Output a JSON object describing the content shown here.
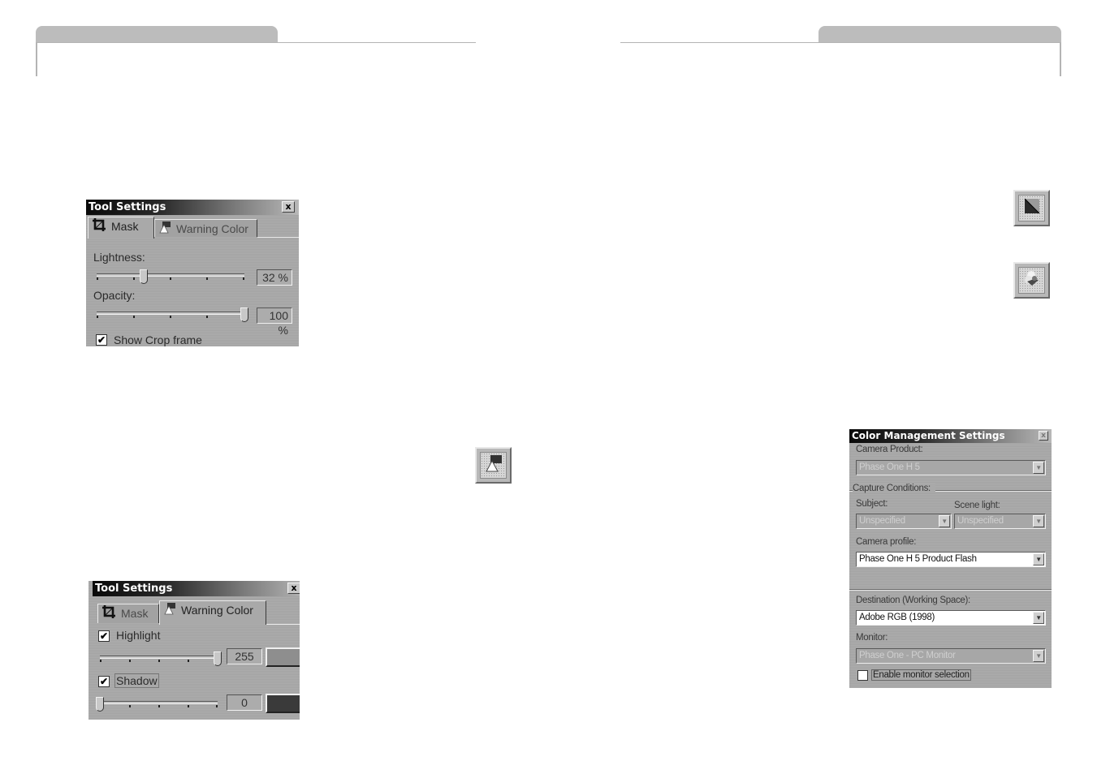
{
  "page": {
    "background": "#ffffff",
    "header_tab_color": "#bcbcbc"
  },
  "tool_settings_mask": {
    "title": "Tool Settings",
    "close_label": "x",
    "tabs": [
      {
        "label": "Mask",
        "icon": "crop-icon",
        "active": true
      },
      {
        "label": "Warning Color",
        "icon": "warning-color-icon",
        "active": false
      }
    ],
    "lightness": {
      "label": "Lightness:",
      "value": 32,
      "display": "32 %"
    },
    "opacity": {
      "label": "Opacity:",
      "value": 100,
      "display": "100 %"
    },
    "show_crop_frame": {
      "label": "Show Crop frame",
      "checked": true,
      "check_glyph": "✔"
    }
  },
  "tool_settings_warning": {
    "title": "Tool Settings",
    "close_label": "x",
    "tabs": [
      {
        "label": "Mask",
        "icon": "crop-icon",
        "active": false
      },
      {
        "label": "Warning Color",
        "icon": "warning-color-icon",
        "active": true
      }
    ],
    "highlight": {
      "label": "Highlight",
      "checked": true,
      "value": 255,
      "display": "255",
      "swatch_color": "#8e8e8e"
    },
    "shadow": {
      "label": "Shadow",
      "checked": true,
      "value": 0,
      "display": "0",
      "swatch_color": "#3a3a3a"
    },
    "check_glyph": "✔"
  },
  "color_management": {
    "title": "Color Management Settings",
    "close_label": "x",
    "camera_product": {
      "label": "Camera Product:",
      "value": "Phase One H 5",
      "enabled": false
    },
    "capture_conditions": {
      "label": "Capture Conditions:"
    },
    "subject": {
      "label": "Subject:",
      "value": "Unspecified",
      "enabled": false
    },
    "scene_light": {
      "label": "Scene light:",
      "value": "Unspecified",
      "enabled": false
    },
    "camera_profile": {
      "label": "Camera profile:",
      "value": "Phase One H 5  Product Flash",
      "enabled": true
    },
    "destination": {
      "label": "Destination (Working Space):",
      "value": "Adobe RGB (1998)",
      "enabled": true
    },
    "monitor": {
      "label": "Monitor:",
      "value": "Phase One - PC Monitor",
      "enabled": false
    },
    "enable_monitor_selection": {
      "label": "Enable monitor selection",
      "checked": false
    },
    "dropdown_glyph": "▼"
  },
  "tool_icons": [
    {
      "name": "warning-color-tool",
      "icon": "warning-color-icon"
    },
    {
      "name": "exposure-tool",
      "icon": "half-square-icon"
    },
    {
      "name": "color-management-tool",
      "icon": "color-flower-icon"
    }
  ]
}
